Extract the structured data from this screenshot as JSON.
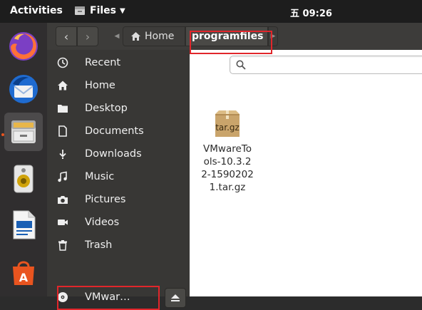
{
  "topbar": {
    "activities_label": "Activities",
    "app_name": "Files",
    "clock": "五 09:26"
  },
  "dock": {
    "items": [
      "firefox-icon",
      "thunderbird-icon",
      "files-icon",
      "rhythmbox-icon",
      "libreoffice-writer-icon",
      "software-icon"
    ],
    "active_item": "files-icon"
  },
  "headerbar": {
    "path": [
      {
        "label": "Home",
        "icon": "home-icon"
      },
      {
        "label": "programfiles",
        "current": true
      }
    ]
  },
  "sidebar": {
    "items": [
      {
        "label": "Recent",
        "icon": "clock-icon"
      },
      {
        "label": "Home",
        "icon": "home-icon"
      },
      {
        "label": "Desktop",
        "icon": "folder-icon"
      },
      {
        "label": "Documents",
        "icon": "document-icon"
      },
      {
        "label": "Downloads",
        "icon": "download-icon"
      },
      {
        "label": "Music",
        "icon": "music-icon"
      },
      {
        "label": "Pictures",
        "icon": "camera-icon"
      },
      {
        "label": "Videos",
        "icon": "video-icon"
      },
      {
        "label": "Trash",
        "icon": "trash-icon"
      },
      {
        "label": "VMwar…",
        "icon": "disc-icon"
      }
    ]
  },
  "content": {
    "files": [
      {
        "icon_label": "tar.gz",
        "name": "VMwareTools-10.3.22-15902021.tar.gz"
      }
    ]
  },
  "colors": {
    "accent": "#e9541f",
    "highlight": "#e1262b"
  }
}
